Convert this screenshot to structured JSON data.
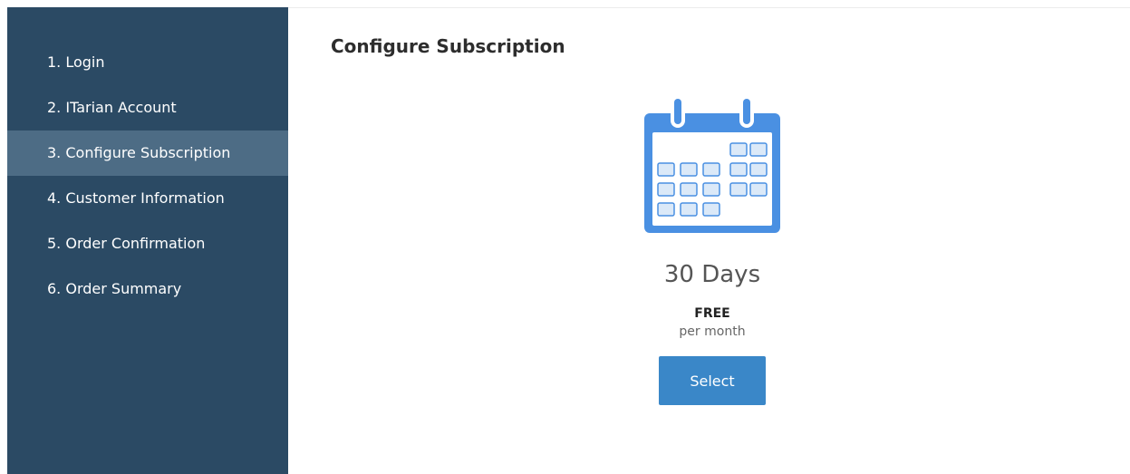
{
  "sidebar": {
    "steps": [
      {
        "label": "1. Login"
      },
      {
        "label": "2. ITarian Account"
      },
      {
        "label": "3. Configure Subscription"
      },
      {
        "label": "4. Customer Information"
      },
      {
        "label": "5. Order Confirmation"
      },
      {
        "label": "6. Order Summary"
      }
    ],
    "active_step": 3
  },
  "main": {
    "title": "Configure Subscription",
    "plan": {
      "icon": "calendar-icon",
      "duration": "30 Days",
      "price": "FREE",
      "period": "per month",
      "select_label": "Select"
    }
  },
  "colors": {
    "sidebar_bg": "#2b4a64",
    "sidebar_active_bg": "#4d6c85",
    "accent": "#3a87c8",
    "calendar_blue": "#4a90e2",
    "calendar_cell": "#dbe9f8"
  }
}
